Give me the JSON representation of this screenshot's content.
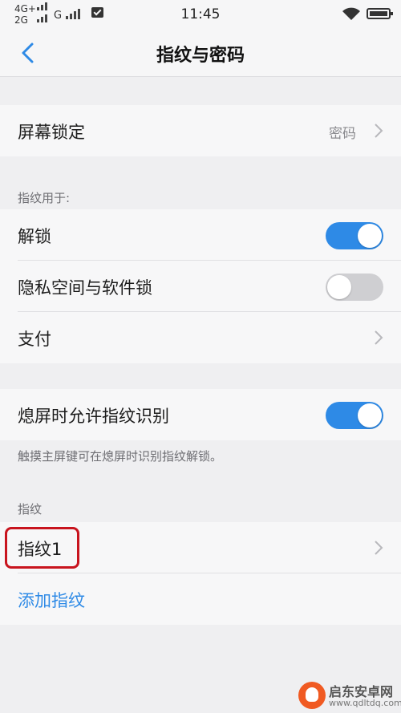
{
  "status_bar": {
    "network_top": "4G+",
    "network_bottom": "2G",
    "network_g": "G",
    "time": "11:45"
  },
  "nav": {
    "title": "指纹与密码"
  },
  "screen_lock": {
    "label": "屏幕锁定",
    "value": "密码"
  },
  "fingerprint_usage": {
    "header": "指纹用于:",
    "unlock_label": "解锁",
    "unlock_enabled": true,
    "privacy_label": "隐私空间与软件锁",
    "privacy_enabled": false,
    "payment_label": "支付"
  },
  "screen_off": {
    "label": "熄屏时允许指纹识别",
    "enabled": true,
    "hint": "触摸主屏键可在熄屏时识别指纹解锁。"
  },
  "fingerprints": {
    "header": "指纹",
    "items": [
      {
        "label": "指纹1"
      }
    ],
    "add_label": "添加指纹"
  },
  "watermark": {
    "name": "启东安卓网",
    "url": "www.qdltdq.com"
  },
  "colors": {
    "accent": "#2e8ae6",
    "toggle_off": "#cfcfd2",
    "highlight": "#c8141e"
  }
}
